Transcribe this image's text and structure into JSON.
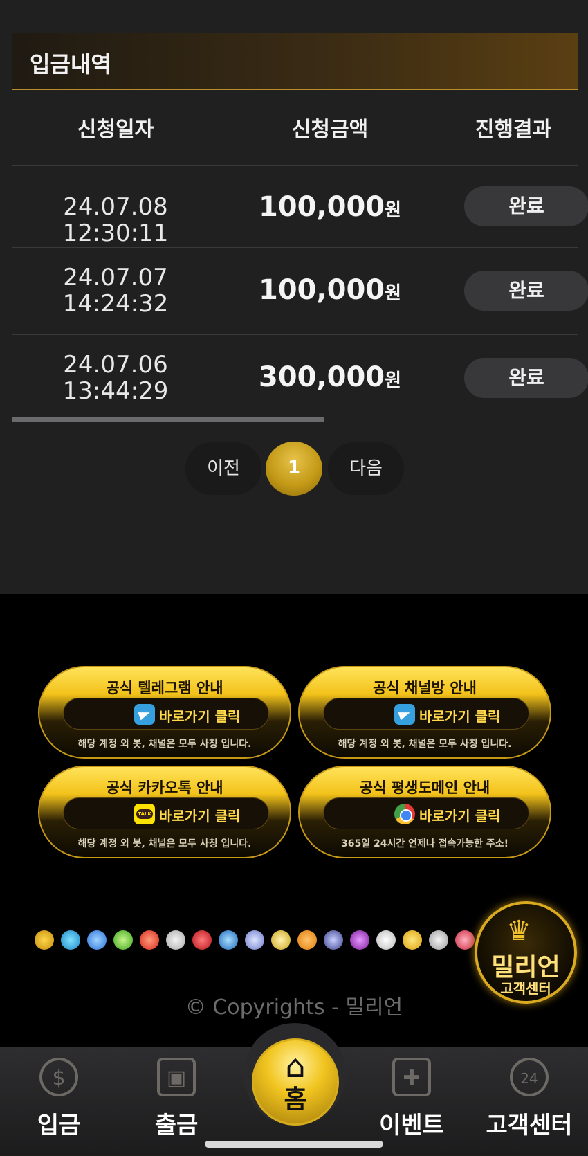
{
  "panel": {
    "title": "입금내역"
  },
  "table": {
    "headers": [
      "신청일자",
      "신청금액",
      "진행결과"
    ],
    "rows": [
      {
        "date": "24.07.08 12:30:11",
        "amount": "100,000",
        "unit": "원",
        "status": "완료"
      },
      {
        "date_line1": "24.07.07",
        "date_line2": "14:24:32",
        "amount": "100,000",
        "unit": "원",
        "status": "완료"
      },
      {
        "date_line1": "24.07.06",
        "date_line2": "13:44:29",
        "amount": "300,000",
        "unit": "원",
        "status": "완료"
      }
    ]
  },
  "pagination": {
    "prev": "이전",
    "current": "1",
    "next": "다음"
  },
  "banners": [
    {
      "title": "공식 텔레그램 안내",
      "button": "바로가기 클릭",
      "note": "해당 계정 외 봇, 채널은 모두 사칭 입니다.",
      "icon": "telegram-icon"
    },
    {
      "title": "공식 채널방 안내",
      "button": "바로가기 클릭",
      "note": "해당 계정 외 봇, 채널은 모두 사칭 입니다.",
      "icon": "telegram-icon"
    },
    {
      "title": "공식 카카오톡 안내",
      "button": "바로가기 클릭",
      "note": "해당 계정 외 봇, 채널은 모두 사칭 입니다.",
      "icon": "kakaotalk-icon"
    },
    {
      "title": "공식 평생도메인 안내",
      "button": "바로가기 클릭",
      "note": "365일 24시간 언제나 접속가능한 주소!",
      "icon": "chrome-icon"
    }
  ],
  "customer_center": {
    "name": "밀리언",
    "label": "고객센터"
  },
  "copyright": "© Copyrights - 밀리언",
  "bottom_nav": {
    "deposit": "입금",
    "withdraw": "출금",
    "home": "홈",
    "event": "이벤트",
    "support": "고객센터"
  },
  "colors": {
    "accent_gold": "#d9a91f",
    "panel_bg": "#202021"
  }
}
